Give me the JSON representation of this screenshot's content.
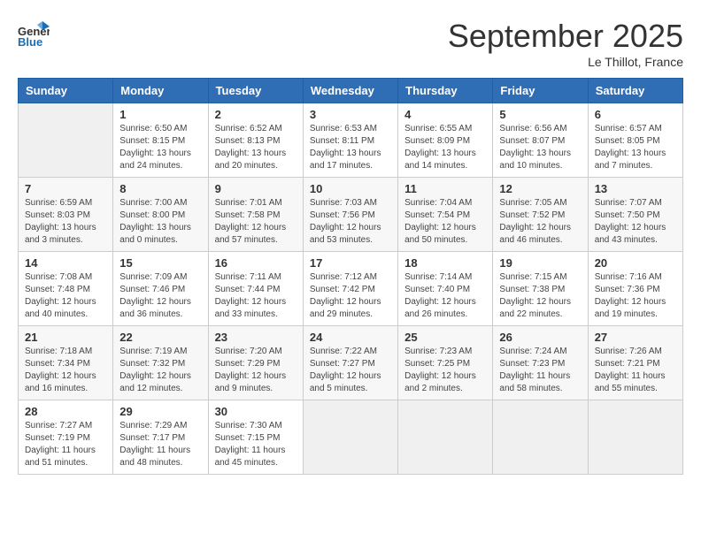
{
  "header": {
    "logo_general": "General",
    "logo_blue": "Blue",
    "month_title": "September 2025",
    "location": "Le Thillot, France"
  },
  "days_of_week": [
    "Sunday",
    "Monday",
    "Tuesday",
    "Wednesday",
    "Thursday",
    "Friday",
    "Saturday"
  ],
  "weeks": [
    [
      {
        "day": "",
        "info": ""
      },
      {
        "day": "1",
        "info": "Sunrise: 6:50 AM\nSunset: 8:15 PM\nDaylight: 13 hours\nand 24 minutes."
      },
      {
        "day": "2",
        "info": "Sunrise: 6:52 AM\nSunset: 8:13 PM\nDaylight: 13 hours\nand 20 minutes."
      },
      {
        "day": "3",
        "info": "Sunrise: 6:53 AM\nSunset: 8:11 PM\nDaylight: 13 hours\nand 17 minutes."
      },
      {
        "day": "4",
        "info": "Sunrise: 6:55 AM\nSunset: 8:09 PM\nDaylight: 13 hours\nand 14 minutes."
      },
      {
        "day": "5",
        "info": "Sunrise: 6:56 AM\nSunset: 8:07 PM\nDaylight: 13 hours\nand 10 minutes."
      },
      {
        "day": "6",
        "info": "Sunrise: 6:57 AM\nSunset: 8:05 PM\nDaylight: 13 hours\nand 7 minutes."
      }
    ],
    [
      {
        "day": "7",
        "info": "Sunrise: 6:59 AM\nSunset: 8:03 PM\nDaylight: 13 hours\nand 3 minutes."
      },
      {
        "day": "8",
        "info": "Sunrise: 7:00 AM\nSunset: 8:00 PM\nDaylight: 13 hours\nand 0 minutes."
      },
      {
        "day": "9",
        "info": "Sunrise: 7:01 AM\nSunset: 7:58 PM\nDaylight: 12 hours\nand 57 minutes."
      },
      {
        "day": "10",
        "info": "Sunrise: 7:03 AM\nSunset: 7:56 PM\nDaylight: 12 hours\nand 53 minutes."
      },
      {
        "day": "11",
        "info": "Sunrise: 7:04 AM\nSunset: 7:54 PM\nDaylight: 12 hours\nand 50 minutes."
      },
      {
        "day": "12",
        "info": "Sunrise: 7:05 AM\nSunset: 7:52 PM\nDaylight: 12 hours\nand 46 minutes."
      },
      {
        "day": "13",
        "info": "Sunrise: 7:07 AM\nSunset: 7:50 PM\nDaylight: 12 hours\nand 43 minutes."
      }
    ],
    [
      {
        "day": "14",
        "info": "Sunrise: 7:08 AM\nSunset: 7:48 PM\nDaylight: 12 hours\nand 40 minutes."
      },
      {
        "day": "15",
        "info": "Sunrise: 7:09 AM\nSunset: 7:46 PM\nDaylight: 12 hours\nand 36 minutes."
      },
      {
        "day": "16",
        "info": "Sunrise: 7:11 AM\nSunset: 7:44 PM\nDaylight: 12 hours\nand 33 minutes."
      },
      {
        "day": "17",
        "info": "Sunrise: 7:12 AM\nSunset: 7:42 PM\nDaylight: 12 hours\nand 29 minutes."
      },
      {
        "day": "18",
        "info": "Sunrise: 7:14 AM\nSunset: 7:40 PM\nDaylight: 12 hours\nand 26 minutes."
      },
      {
        "day": "19",
        "info": "Sunrise: 7:15 AM\nSunset: 7:38 PM\nDaylight: 12 hours\nand 22 minutes."
      },
      {
        "day": "20",
        "info": "Sunrise: 7:16 AM\nSunset: 7:36 PM\nDaylight: 12 hours\nand 19 minutes."
      }
    ],
    [
      {
        "day": "21",
        "info": "Sunrise: 7:18 AM\nSunset: 7:34 PM\nDaylight: 12 hours\nand 16 minutes."
      },
      {
        "day": "22",
        "info": "Sunrise: 7:19 AM\nSunset: 7:32 PM\nDaylight: 12 hours\nand 12 minutes."
      },
      {
        "day": "23",
        "info": "Sunrise: 7:20 AM\nSunset: 7:29 PM\nDaylight: 12 hours\nand 9 minutes."
      },
      {
        "day": "24",
        "info": "Sunrise: 7:22 AM\nSunset: 7:27 PM\nDaylight: 12 hours\nand 5 minutes."
      },
      {
        "day": "25",
        "info": "Sunrise: 7:23 AM\nSunset: 7:25 PM\nDaylight: 12 hours\nand 2 minutes."
      },
      {
        "day": "26",
        "info": "Sunrise: 7:24 AM\nSunset: 7:23 PM\nDaylight: 11 hours\nand 58 minutes."
      },
      {
        "day": "27",
        "info": "Sunrise: 7:26 AM\nSunset: 7:21 PM\nDaylight: 11 hours\nand 55 minutes."
      }
    ],
    [
      {
        "day": "28",
        "info": "Sunrise: 7:27 AM\nSunset: 7:19 PM\nDaylight: 11 hours\nand 51 minutes."
      },
      {
        "day": "29",
        "info": "Sunrise: 7:29 AM\nSunset: 7:17 PM\nDaylight: 11 hours\nand 48 minutes."
      },
      {
        "day": "30",
        "info": "Sunrise: 7:30 AM\nSunset: 7:15 PM\nDaylight: 11 hours\nand 45 minutes."
      },
      {
        "day": "",
        "info": ""
      },
      {
        "day": "",
        "info": ""
      },
      {
        "day": "",
        "info": ""
      },
      {
        "day": "",
        "info": ""
      }
    ]
  ]
}
